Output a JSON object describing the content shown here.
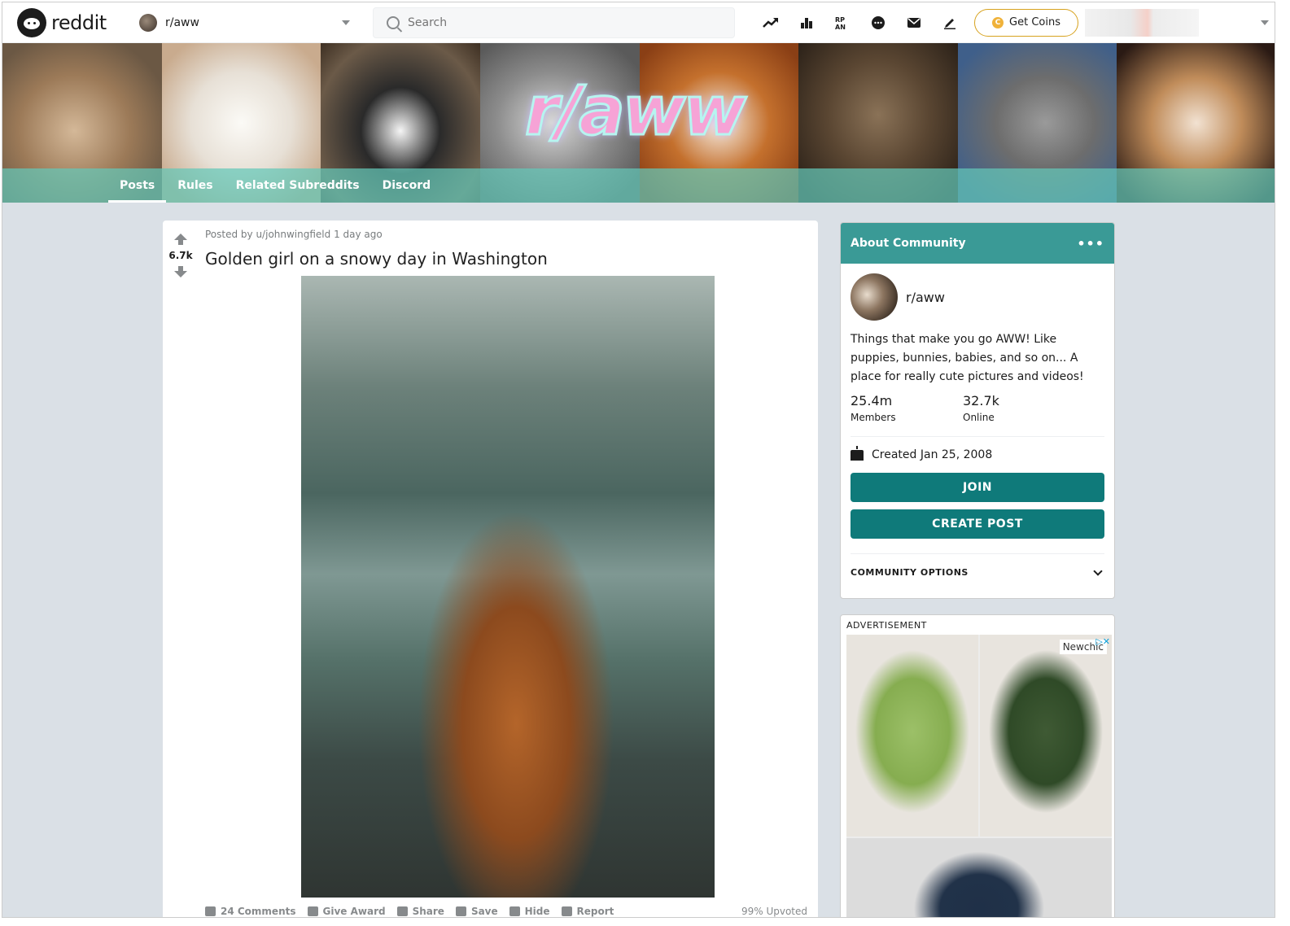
{
  "header": {
    "logo_text": "reddit",
    "community": "r/aww",
    "search_placeholder": "Search",
    "get_coins": "Get Coins",
    "icons": [
      "popular-icon",
      "all-icon",
      "rpan-icon",
      "chat-icon",
      "mail-icon",
      "create-post-icon"
    ]
  },
  "banner": {
    "title": "r/aww",
    "tabs": [
      "Posts",
      "Rules",
      "Related Subreddits",
      "Discord"
    ],
    "active_tab": "Posts"
  },
  "post": {
    "votes": "6.7k",
    "meta": "Posted by u/johnwingfield 1 day ago",
    "title": "Golden girl on a snowy day in Washington",
    "actions": [
      "24 Comments",
      "Give Award",
      "Share",
      "Save",
      "Hide",
      "Report"
    ],
    "upvoted": "99% Upvoted"
  },
  "about": {
    "heading": "About Community",
    "more": "•••",
    "community_name": "r/aww",
    "description": "Things that make you go AWW! Like puppies, bunnies, babies, and so on... A place for really cute pictures and videos!",
    "members_value": "25.4m",
    "members_label": "Members",
    "online_value": "32.7k",
    "online_label": "Online",
    "created": "Created Jan 25, 2008",
    "join_label": "JOIN",
    "create_post_label": "CREATE POST",
    "options_label": "COMMUNITY OPTIONS"
  },
  "ad": {
    "label": "ADVERTISEMENT",
    "brand": "Newchic"
  },
  "colors": {
    "accent": "#0f7a7a",
    "about_header": "#3a9a96",
    "banner_nav": "#64c8b9",
    "coin_border": "#d7a21e"
  }
}
